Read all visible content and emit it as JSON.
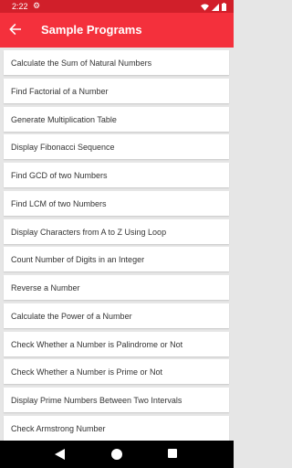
{
  "status": {
    "time": "2:22"
  },
  "app_bar": {
    "title": "Sample Programs"
  },
  "items": [
    "Calculate the Sum of Natural Numbers",
    "Find Factorial of a Number",
    "Generate Multiplication Table",
    "Display Fibonacci Sequence",
    "Find GCD of two Numbers",
    "Find LCM of two Numbers",
    "Display Characters from A to Z Using Loop",
    "Count Number of Digits in an Integer",
    "Reverse a Number",
    "Calculate the Power of a Number",
    "Check Whether a Number is Palindrome or Not",
    "Check Whether a Number is Prime or Not",
    "Display Prime Numbers Between Two Intervals",
    "Check Armstrong Number"
  ],
  "colors": {
    "accent": "#f4303c",
    "status_bar": "#d11f2a"
  }
}
